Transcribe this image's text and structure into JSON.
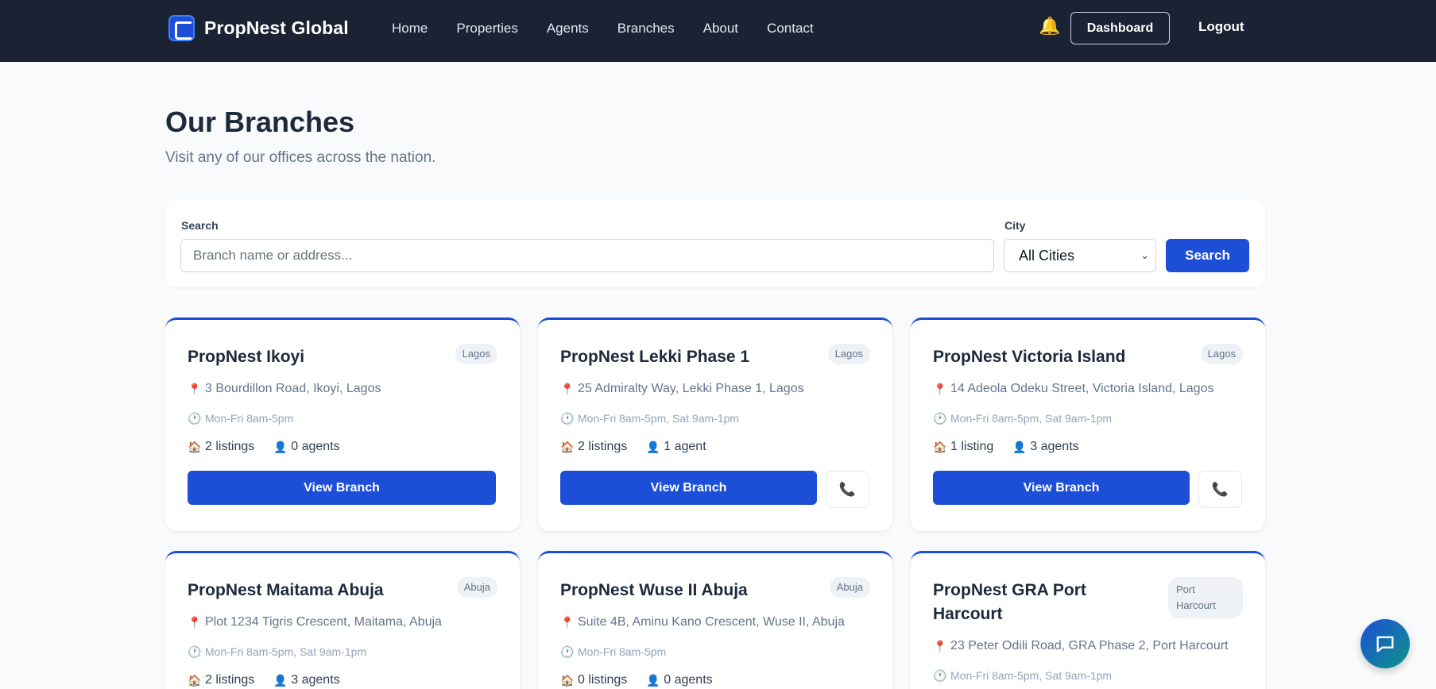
{
  "navbar": {
    "brand": "PropNest Global",
    "links": [
      "Home",
      "Properties",
      "Agents",
      "Branches",
      "About",
      "Contact"
    ],
    "dashboard_label": "Dashboard",
    "logout_label": "Logout"
  },
  "header": {
    "title": "Our Branches",
    "subtitle": "Visit any of our offices across the nation."
  },
  "filter": {
    "search_label": "Search",
    "search_placeholder": "Branch name or address...",
    "city_label": "City",
    "city_value": "All Cities",
    "search_button": "Search"
  },
  "branches": [
    {
      "name": "PropNest Ikoyi",
      "city": "Lagos",
      "address": "3 Bourdillon Road, Ikoyi, Lagos",
      "hours": "Mon-Fri 8am-5pm",
      "listings": "2 listings",
      "agents": "0 agents",
      "view_label": "View Branch"
    },
    {
      "name": "PropNest Lekki Phase 1",
      "city": "Lagos",
      "address": "25 Admiralty Way, Lekki Phase 1, Lagos",
      "hours": "Mon-Fri 8am-5pm, Sat 9am-1pm",
      "listings": "2 listings",
      "agents": "1 agent",
      "view_label": "View Branch"
    },
    {
      "name": "PropNest Victoria Island",
      "city": "Lagos",
      "address": "14 Adeola Odeku Street, Victoria Island, Lagos",
      "hours": "Mon-Fri 8am-5pm, Sat 9am-1pm",
      "listings": "1 listing",
      "agents": "3 agents",
      "view_label": "View Branch"
    },
    {
      "name": "PropNest Maitama Abuja",
      "city": "Abuja",
      "address": "Plot 1234 Tigris Crescent, Maitama, Abuja",
      "hours": "Mon-Fri 8am-5pm, Sat 9am-1pm",
      "listings": "2 listings",
      "agents": "3 agents"
    },
    {
      "name": "PropNest Wuse II Abuja",
      "city": "Abuja",
      "address": "Suite 4B, Aminu Kano Crescent, Wuse II, Abuja",
      "hours": "Mon-Fri 8am-5pm",
      "listings": "0 listings",
      "agents": "0 agents"
    },
    {
      "name": "PropNest GRA Port Harcourt",
      "city": "Port Harcourt",
      "address": "23 Peter Odili Road, GRA Phase 2, Port Harcourt",
      "hours": "Mon-Fri 8am-5pm, Sat 9am-1pm"
    }
  ],
  "icons": {
    "bell": "bell-icon",
    "pin": "map-pin-icon",
    "clock": "clock-icon",
    "house": "house-icon",
    "person": "person-icon",
    "phone": "phone-icon",
    "chat": "chat-icon"
  },
  "colors": {
    "navbar_bg": "#1a2233",
    "primary": "#1d4ed8",
    "page_bg": "#f8fafc",
    "phone_accent": "#db2777"
  }
}
